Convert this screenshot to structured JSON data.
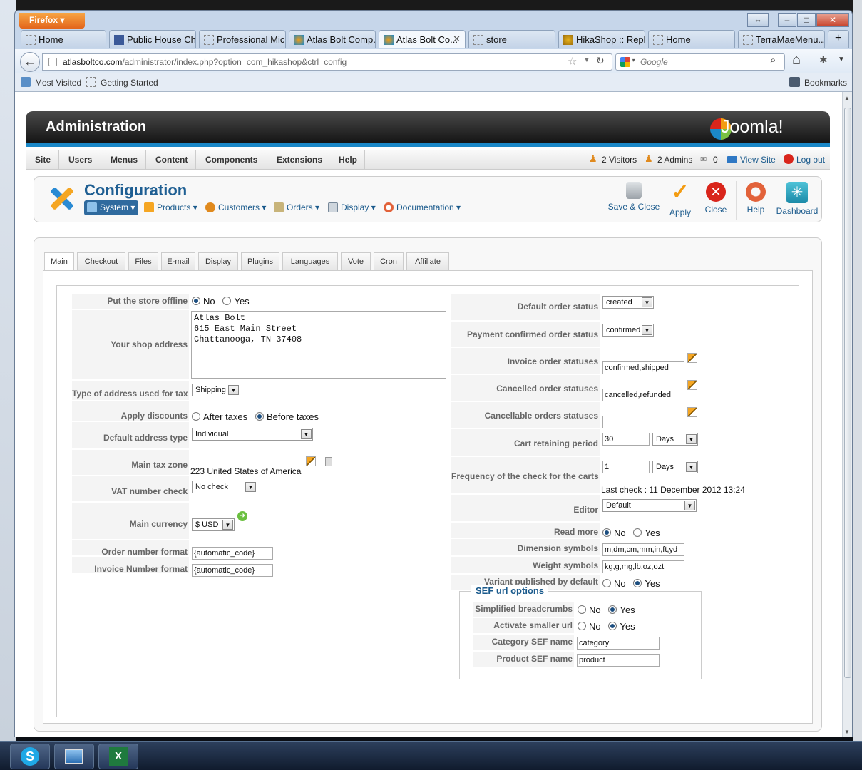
{
  "browser": {
    "app_button": "Firefox",
    "tabs": [
      {
        "label": "Home",
        "active": false
      },
      {
        "label": "Public House Ch...",
        "active": false
      },
      {
        "label": "Professional Mic...",
        "active": false
      },
      {
        "label": "Atlas Bolt Comp...",
        "active": false
      },
      {
        "label": "Atlas Bolt Co...",
        "active": true
      },
      {
        "label": "store",
        "active": false
      },
      {
        "label": "HikaShop :: Repl...",
        "active": false
      },
      {
        "label": "Home",
        "active": false
      },
      {
        "label": "TerraMaeMenu....",
        "active": false
      }
    ],
    "new_tab": "+",
    "url_host": "atlasboltco.com",
    "url_path": "/administrator/index.php?option=com_hikashop&ctrl=config",
    "search_placeholder": "Google",
    "bookmarks": {
      "most_visited": "Most Visited",
      "getting_started": "Getting Started",
      "bookmarks": "Bookmarks"
    }
  },
  "admin": {
    "title": "Administration",
    "logo": "Joomla!",
    "menu": [
      "Site",
      "Users",
      "Menus",
      "Content",
      "Components",
      "Extensions",
      "Help"
    ],
    "status": {
      "visitors": "2 Visitors",
      "admins": "2 Admins",
      "messages": "0",
      "view_site": "View Site",
      "logout": "Log out"
    }
  },
  "toolbar": {
    "title": "Configuration",
    "submenu": [
      "System",
      "Products",
      "Customers",
      "Orders",
      "Display",
      "Documentation"
    ],
    "buttons": {
      "save_close": "Save & Close",
      "apply": "Apply",
      "close": "Close",
      "help": "Help",
      "dashboard": "Dashboard"
    }
  },
  "config_tabs": [
    "Main",
    "Checkout",
    "Files",
    "E-mail",
    "Display",
    "Plugins",
    "Languages",
    "Vote",
    "Cron",
    "Affiliate"
  ],
  "left": {
    "store_offline": {
      "label": "Put the store offline",
      "no": "No",
      "yes": "Yes",
      "value": "No"
    },
    "shop_address": {
      "label": "Your shop address",
      "value": "Atlas Bolt\n615 East Main Street\nChattanooga, TN 37408"
    },
    "address_tax": {
      "label": "Type of address used for tax",
      "value": "Shipping"
    },
    "apply_discounts": {
      "label": "Apply discounts",
      "after": "After taxes",
      "before": "Before taxes",
      "value": "Before taxes"
    },
    "default_address": {
      "label": "Default address type",
      "value": "Individual"
    },
    "tax_zone": {
      "label": "Main tax zone",
      "value": "223 United States of America"
    },
    "vat_check": {
      "label": "VAT number check",
      "value": "No check"
    },
    "currency": {
      "label": "Main currency",
      "value": "$ USD"
    },
    "order_format": {
      "label": "Order number format",
      "value": "{automatic_code}"
    },
    "invoice_format": {
      "label": "Invoice Number format",
      "value": "{automatic_code}"
    }
  },
  "right": {
    "default_status": {
      "label": "Default order status",
      "value": "created"
    },
    "payment_status": {
      "label": "Payment confirmed order status",
      "value": "confirmed"
    },
    "invoice_statuses": {
      "label": "Invoice order statuses",
      "value": "confirmed,shipped"
    },
    "cancelled_statuses": {
      "label": "Cancelled order statuses",
      "value": "cancelled,refunded"
    },
    "cancellable_statuses": {
      "label": "Cancellable orders statuses",
      "value": ""
    },
    "cart_retaining": {
      "label": "Cart retaining period",
      "value": "30",
      "unit": "Days"
    },
    "check_frequency": {
      "label": "Frequency of the check for the carts",
      "value": "1",
      "unit": "Days",
      "last_check": "Last check : 11 December 2012 13:24"
    },
    "editor": {
      "label": "Editor",
      "value": "Default"
    },
    "read_more": {
      "label": "Read more",
      "no": "No",
      "yes": "Yes",
      "value": "No"
    },
    "dimension": {
      "label": "Dimension symbols",
      "value": "m,dm,cm,mm,in,ft,yd"
    },
    "weight": {
      "label": "Weight symbols",
      "value": "kg,g,mg,lb,oz,ozt"
    },
    "variant": {
      "label": "Variant published by default",
      "no": "No",
      "yes": "Yes",
      "value": "Yes"
    }
  },
  "sef": {
    "legend": "SEF url options",
    "breadcrumbs": {
      "label": "Simplified breadcrumbs",
      "no": "No",
      "yes": "Yes",
      "value": "Yes"
    },
    "smaller_url": {
      "label": "Activate smaller url",
      "no": "No",
      "yes": "Yes",
      "value": "Yes"
    },
    "category_name": {
      "label": "Category SEF name",
      "value": "category"
    },
    "product_name": {
      "label": "Product SEF name",
      "value": "product"
    }
  },
  "colors": {
    "accent": "#1b88c8",
    "title_blue": "#1f5f93",
    "close_red": "#d9251b",
    "apply_orange": "#f39c12"
  }
}
